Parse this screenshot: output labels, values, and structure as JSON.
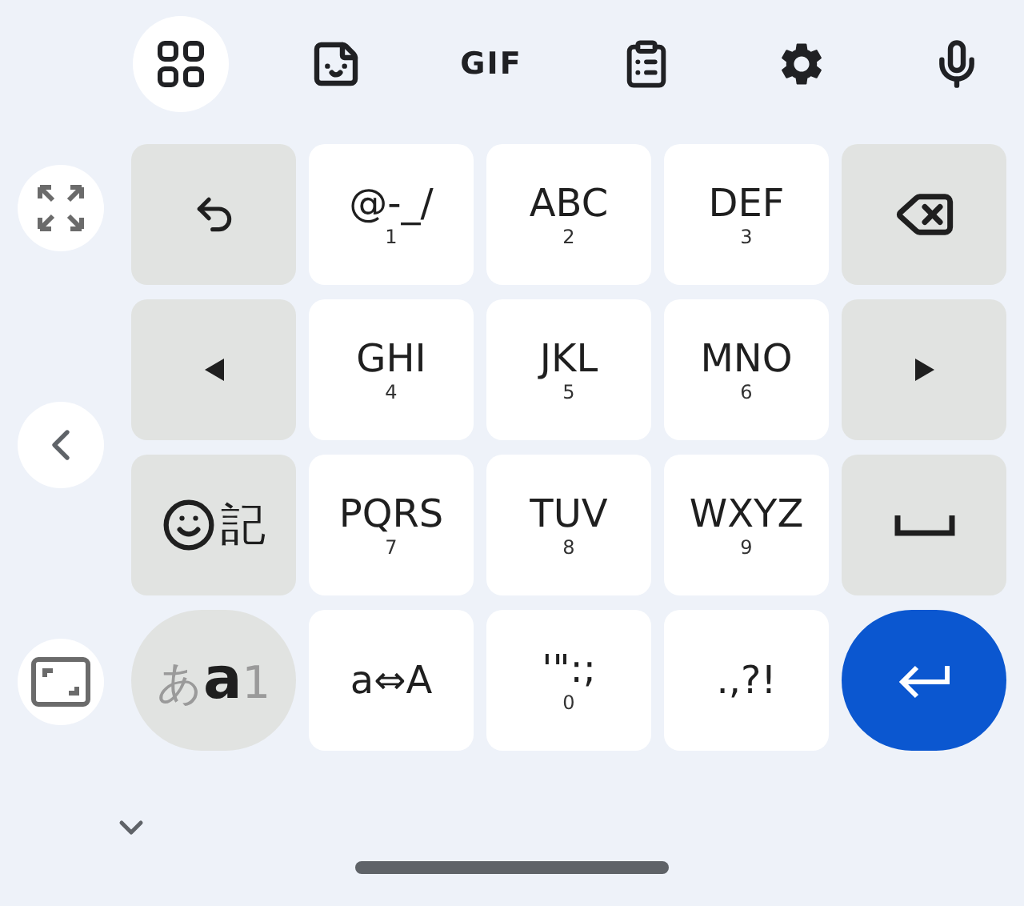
{
  "toolbar": [
    {
      "kind": "grid",
      "selected": true
    },
    {
      "kind": "sticker",
      "selected": false
    },
    {
      "kind": "text",
      "label": "GIF",
      "selected": false
    },
    {
      "kind": "clipboard",
      "selected": false
    },
    {
      "kind": "settings",
      "selected": false
    },
    {
      "kind": "mic",
      "selected": false
    }
  ],
  "side_buttons": [
    {
      "kind": "expand"
    },
    {
      "kind": "collapse-left"
    },
    {
      "kind": "resize"
    }
  ],
  "keys": [
    {
      "kind": "undo"
    },
    {
      "kind": "char",
      "label": "@-_/",
      "digit": "1"
    },
    {
      "kind": "char",
      "label": "ABC",
      "digit": "2"
    },
    {
      "kind": "char",
      "label": "DEF",
      "digit": "3"
    },
    {
      "kind": "backspace"
    },
    {
      "kind": "left"
    },
    {
      "kind": "char",
      "label": "GHI",
      "digit": "4"
    },
    {
      "kind": "char",
      "label": "JKL",
      "digit": "5"
    },
    {
      "kind": "char",
      "label": "MNO",
      "digit": "6"
    },
    {
      "kind": "right"
    },
    {
      "kind": "emoji",
      "label": "記"
    },
    {
      "kind": "char",
      "label": "PQRS",
      "digit": "7"
    },
    {
      "kind": "char",
      "label": "TUV",
      "digit": "8"
    },
    {
      "kind": "char",
      "label": "WXYZ",
      "digit": "9"
    },
    {
      "kind": "space"
    },
    {
      "kind": "mode",
      "parts": [
        {
          "text": "あ",
          "selected": false
        },
        {
          "text": "a",
          "selected": true
        },
        {
          "text": "1",
          "selected": false
        }
      ]
    },
    {
      "kind": "char",
      "label": "a⇔A"
    },
    {
      "kind": "char",
      "label": "'\":;",
      "digit": "0"
    },
    {
      "kind": "char",
      "label": ".,?!"
    },
    {
      "kind": "enter"
    }
  ]
}
